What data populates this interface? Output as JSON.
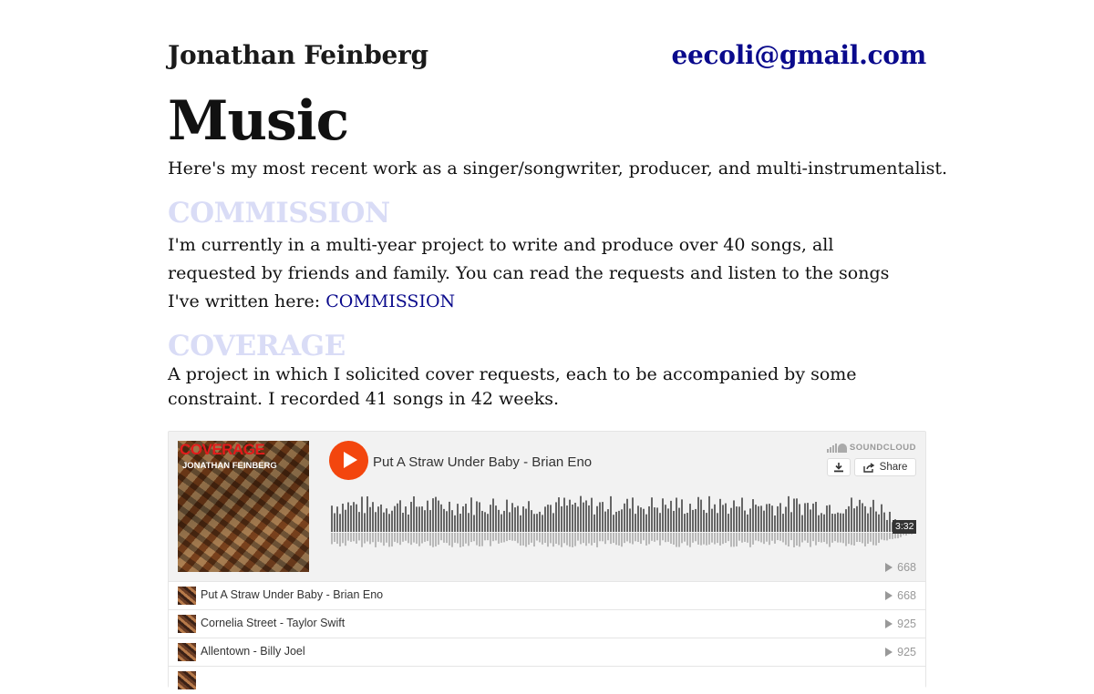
{
  "header": {
    "name": "Jonathan Feinberg",
    "email": "eecoli@gmail.com"
  },
  "page": {
    "title": "Music",
    "intro": "Here's my most recent work as a singer/songwriter, producer, and multi-instrumentalist."
  },
  "sections": {
    "commission": {
      "heading": "COMMISSION",
      "text": "I'm currently in a multi-year project to write and produce over 40 songs, all requested by friends and family. You can read the requests and listen to the songs I've written here: ",
      "link": "COMMISSION"
    },
    "coverage": {
      "heading": "COVERAGE",
      "text": "A project in which I solicited cover requests, each to be accompanied by some constraint. I recorded 41 songs in 42 weeks."
    }
  },
  "player": {
    "art_title": "COVERAGE",
    "art_artist": "JONATHAN FEINBERG",
    "current_track": "Put A Straw Under Baby - Brian Eno",
    "brand": "SOUNDCLOUD",
    "share_label": "Share",
    "duration": "3:32",
    "current_plays": "668",
    "accent_color": "#f3460e",
    "tracks": [
      {
        "title": "Put A Straw Under Baby - Brian Eno",
        "plays": "668"
      },
      {
        "title": "Cornelia Street - Taylor Swift",
        "plays": "925"
      },
      {
        "title": "Allentown - Billy Joel",
        "plays": "925"
      }
    ]
  }
}
